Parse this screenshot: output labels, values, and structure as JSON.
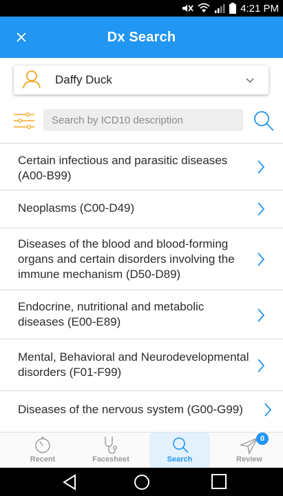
{
  "status_bar": {
    "time": "4:21 PM"
  },
  "header": {
    "title": "Dx Search"
  },
  "patient": {
    "name": "Daffy Duck"
  },
  "search": {
    "placeholder": "Search by ICD10 description",
    "value": ""
  },
  "categories": [
    {
      "label": "Certain infectious and parasitic diseases (A00-B99)"
    },
    {
      "label": "Neoplasms (C00-D49)"
    },
    {
      "label": "Diseases of the blood and blood-forming organs and certain disorders involving the immune mechanism (D50-D89)"
    },
    {
      "label": "Endocrine, nutritional and metabolic diseases (E00-E89)"
    },
    {
      "label": "Mental, Behavioral and Neurodevelopmental disorders (F01-F99)"
    },
    {
      "label": "Diseases of the nervous system (G00-G99)"
    }
  ],
  "bottom_nav": {
    "items": [
      {
        "label": "Recent",
        "icon": "timer-icon"
      },
      {
        "label": "Facesheet",
        "icon": "stethoscope-icon"
      },
      {
        "label": "Search",
        "icon": "search-icon",
        "active": true
      },
      {
        "label": "Review",
        "icon": "send-icon",
        "badge": "0"
      }
    ]
  },
  "colors": {
    "accent": "#2196f3",
    "avatar": "#f5a623",
    "filter_icon": "#f5a623"
  }
}
